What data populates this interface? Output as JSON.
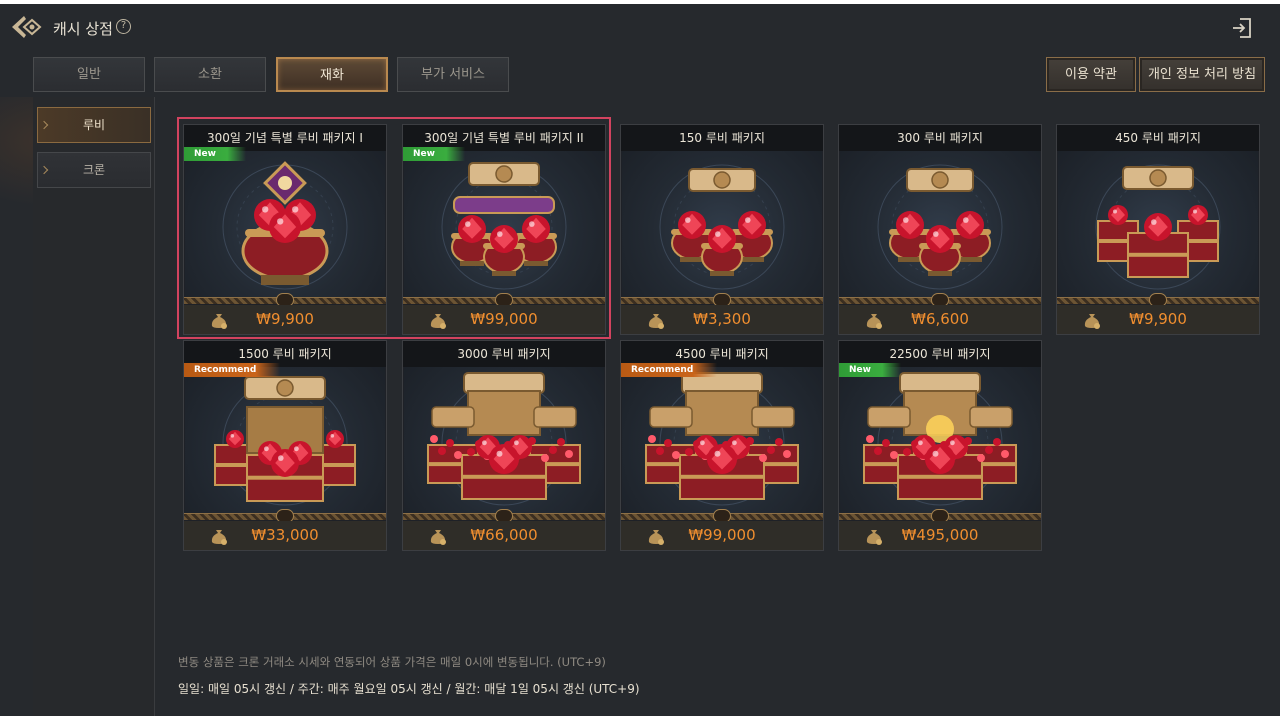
{
  "header": {
    "title": "캐시 상점",
    "help_glyph": "?"
  },
  "tabs": [
    {
      "label": "일반",
      "active": false
    },
    {
      "label": "소환",
      "active": false
    },
    {
      "label": "재화",
      "active": true
    },
    {
      "label": "부가 서비스",
      "active": false
    }
  ],
  "links": {
    "terms": "이용 약관",
    "privacy": "개인 정보 처리 방침"
  },
  "sidebar": {
    "items": [
      {
        "label": "루비",
        "active": true
      },
      {
        "label": "크론",
        "active": false
      }
    ]
  },
  "products": [
    {
      "name": "300일 기념 특별 루비 패키지 I",
      "price": "₩9,900",
      "badge": "New",
      "art": "egg-single"
    },
    {
      "name": "300일 기념 특별 루비 패키지 II",
      "price": "₩99,000",
      "badge": "New",
      "art": "egg-triple"
    },
    {
      "name": "150 루비 패키지",
      "price": "₩3,300",
      "badge": "",
      "art": "pots-3"
    },
    {
      "name": "300 루비 패키지",
      "price": "₩6,600",
      "badge": "",
      "art": "pots-3"
    },
    {
      "name": "450 루비 패키지",
      "price": "₩9,900",
      "badge": "",
      "art": "chest-3"
    },
    {
      "name": "1500 루비 패키지",
      "price": "₩33,000",
      "badge": "Recommend",
      "art": "chest-big"
    },
    {
      "name": "3000 루비 패키지",
      "price": "₩66,000",
      "badge": "",
      "art": "chest-open"
    },
    {
      "name": "4500 루비 패키지",
      "price": "₩99,000",
      "badge": "Recommend",
      "art": "chest-open"
    },
    {
      "name": "22500 루비 패키지",
      "price": "₩495,000",
      "badge": "New",
      "art": "chest-gold"
    }
  ],
  "notices": {
    "variable": "변동 상품은 크론 거래소 시세와 연동되어 상품 가격은 매일 0시에 변동됩니다. (UTC+9)",
    "reset": "일일: 매일 05시 갱신 / 주간: 매주 월요일 05시 갱신 / 월간: 매달 1일 05시 갱신 (UTC+9)"
  },
  "colors": {
    "price": "#f08e2f",
    "highlight": "#d2435f",
    "accent_gold": "#b9894f",
    "badge_new": "#3aad3f",
    "badge_recommend": "#c9641a"
  },
  "icons": {
    "back": "back-emblem-icon",
    "help": "help-circle-icon",
    "exit": "exit-door-icon",
    "bag": "coin-bag-icon"
  }
}
